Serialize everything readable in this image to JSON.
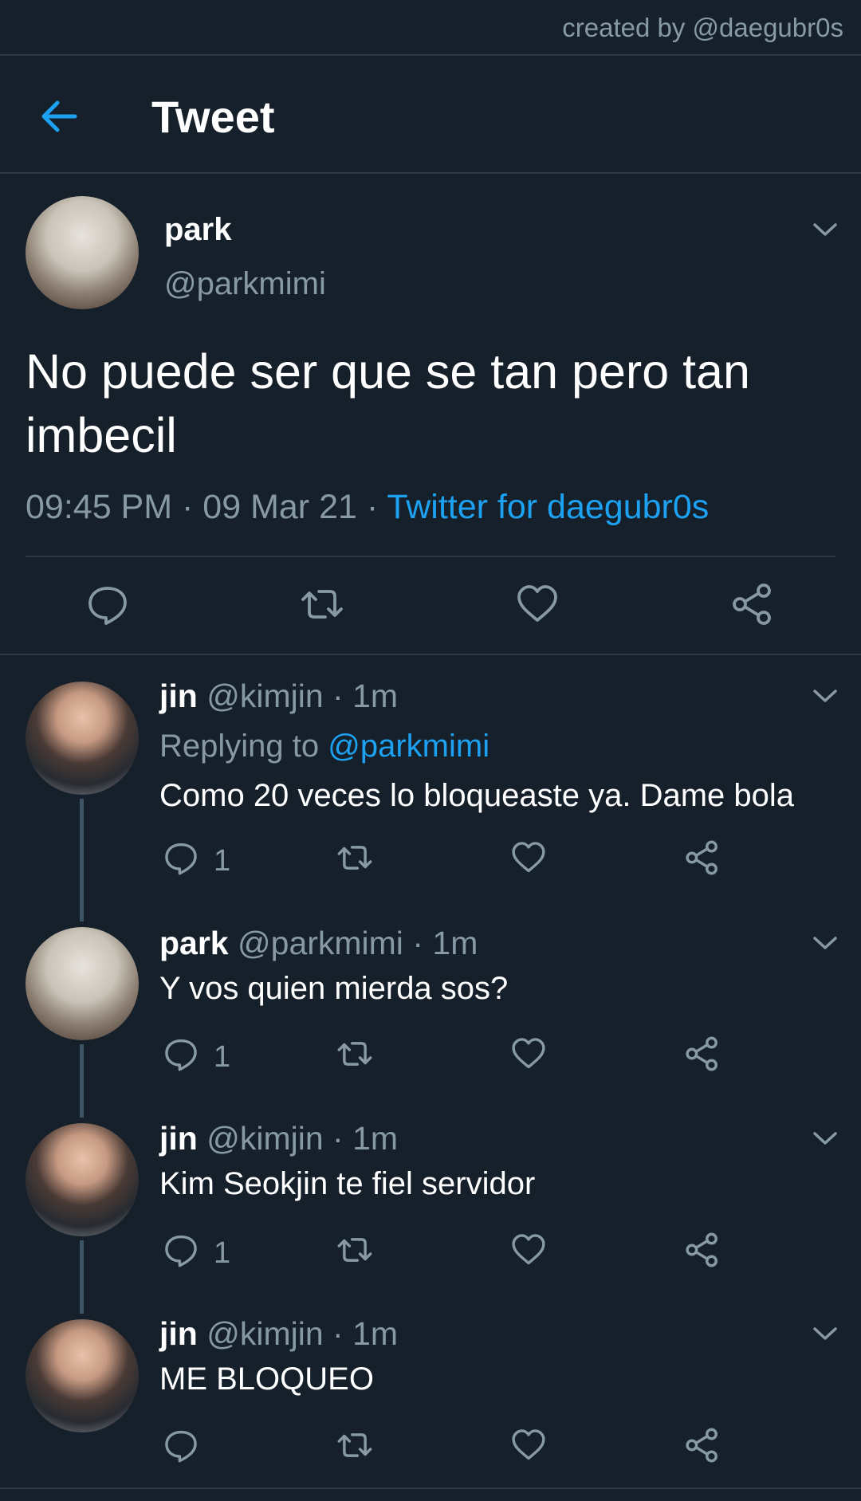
{
  "credit": "created by @daegubr0s",
  "header": {
    "title": "Tweet"
  },
  "main": {
    "name": "park",
    "handle": "@parkmimi",
    "text": "No puede ser que se tan pero tan imbecil",
    "time": "09:45 PM",
    "date": "09 Mar 21",
    "source": "Twitter for daegubr0s",
    "separator": "·"
  },
  "replies": [
    {
      "name": "jin",
      "handle": "@kimjin",
      "time": "1m",
      "replying_prefix": "Replying to",
      "replying_to": "@parkmimi",
      "text": "Como 20 veces lo bloqueaste ya. Dame bola",
      "reply_count": "1"
    },
    {
      "name": "park",
      "handle": "@parkmimi",
      "time": "1m",
      "text": "Y vos quien mierda sos?",
      "reply_count": "1"
    },
    {
      "name": "jin",
      "handle": "@kimjin",
      "time": "1m",
      "text": "Kim Seokjin te fiel servidor",
      "reply_count": "1"
    },
    {
      "name": "jin",
      "handle": "@kimjin",
      "time": "1m",
      "text": "ME BLOQUEO",
      "reply_count": ""
    }
  ],
  "colors": {
    "background": "#15202b",
    "accent": "#1da1f2",
    "muted": "#8899a6",
    "divider": "#2c3a47"
  },
  "icons": [
    "arrow-back-icon",
    "chevron-down-icon",
    "comment-icon",
    "retweet-icon",
    "heart-icon",
    "share-icon"
  ]
}
